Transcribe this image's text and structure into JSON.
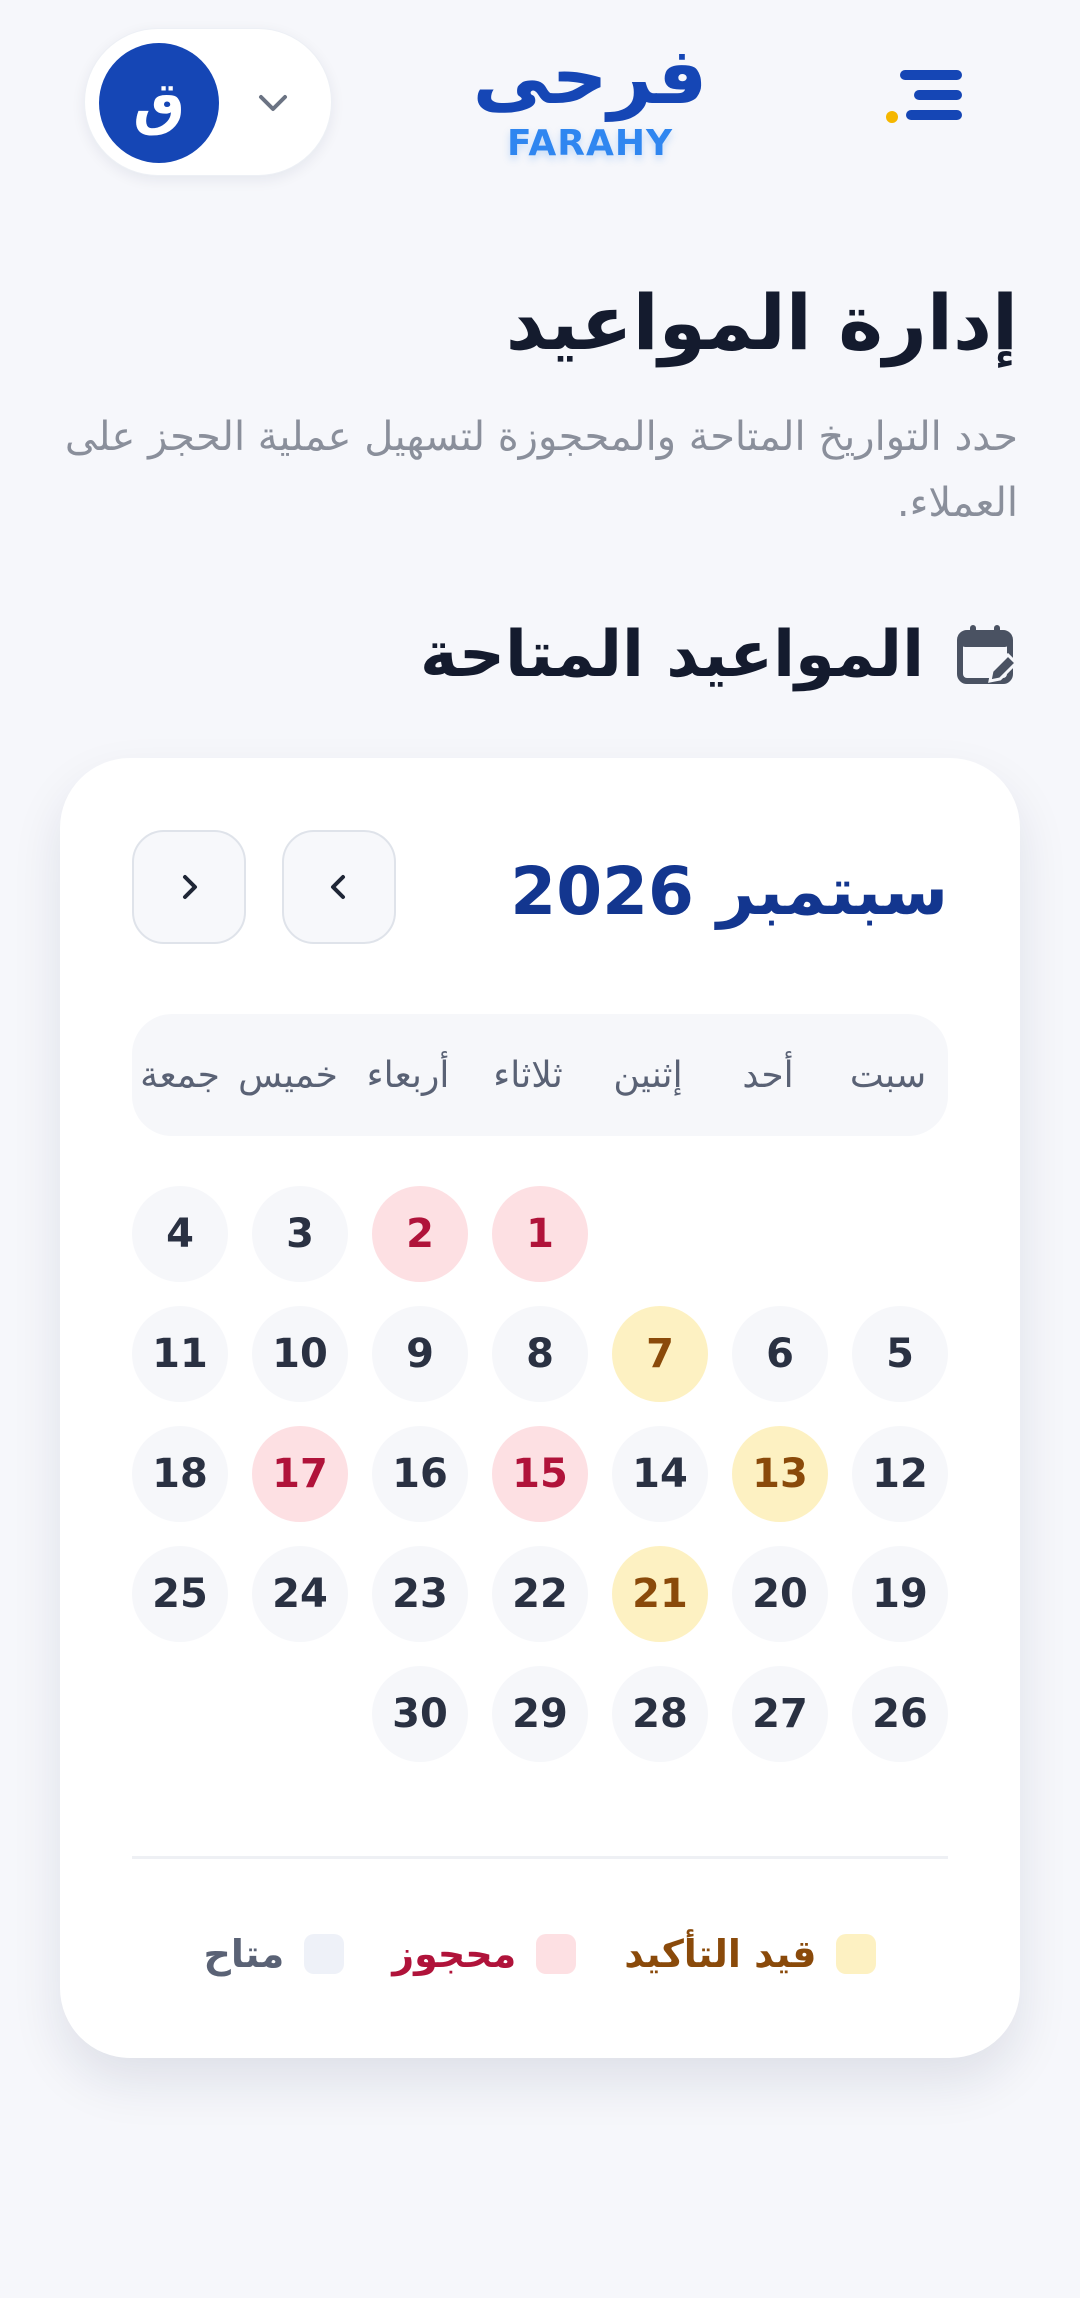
{
  "header": {
    "avatar_initial": "ق",
    "brand_ar": "فرحى",
    "brand_en": "FARAHY"
  },
  "page": {
    "title": "إدارة المواعيد",
    "subtitle": "حدد التواريخ المتاحة والمحجوزة لتسهيل عملية الحجز على العملاء."
  },
  "section": {
    "title": "المواعيد المتاحة"
  },
  "calendar": {
    "month_label": "سبتمبر 2026",
    "weekdays": [
      "سبت",
      "أحد",
      "إثنين",
      "ثلاثاء",
      "أربعاء",
      "خميس",
      "جمعة"
    ],
    "first_day_column": 3,
    "days_in_month": 30,
    "booked_days": [
      1,
      2,
      15,
      17
    ],
    "pending_days": [
      7,
      13,
      21
    ]
  },
  "legend": {
    "pending": "قيد التأكيد",
    "booked": "محجوز",
    "available": "متاح"
  },
  "colors": {
    "primary": "#1546b5",
    "booked_bg": "#fde0e3",
    "booked_text": "#b0133a",
    "pending_bg": "#fdf1c2",
    "pending_text": "#8a4a0a",
    "available_bg": "#eef1f8",
    "available_text": "#5a6275"
  }
}
